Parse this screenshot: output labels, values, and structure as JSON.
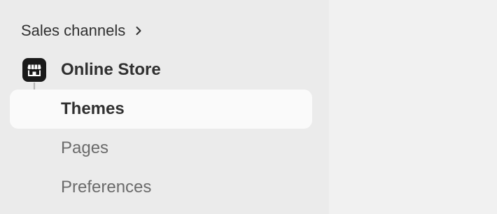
{
  "sidebar": {
    "section_title": "Sales channels",
    "channel": {
      "label": "Online Store",
      "icon": "storefront-icon"
    },
    "sub_items": [
      {
        "label": "Themes",
        "selected": true
      },
      {
        "label": "Pages",
        "selected": false
      },
      {
        "label": "Preferences",
        "selected": false
      }
    ]
  },
  "colors": {
    "sidebar_bg": "#ebebeb",
    "main_bg": "#f1f1f1",
    "selected_bg": "#fafafa",
    "text_primary": "#303030",
    "text_secondary": "#6b6b6b",
    "icon_bg": "#1a1a1a",
    "connector": "#b5b5b5"
  }
}
